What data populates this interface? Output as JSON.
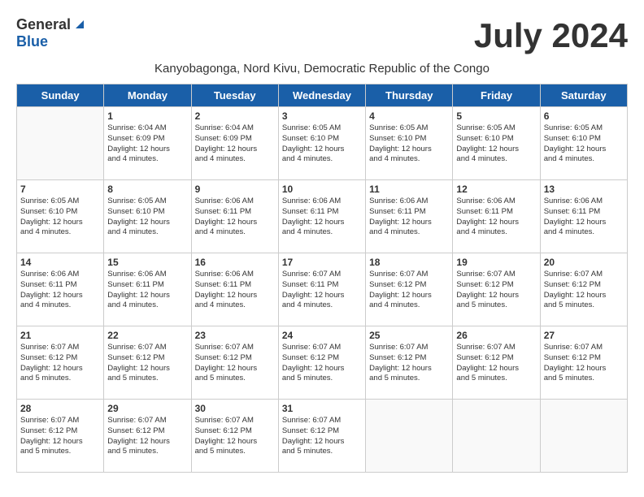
{
  "logo": {
    "general": "General",
    "blue": "Blue"
  },
  "title": "July 2024",
  "location": "Kanyobagonga, Nord Kivu, Democratic Republic of the Congo",
  "days_of_week": [
    "Sunday",
    "Monday",
    "Tuesday",
    "Wednesday",
    "Thursday",
    "Friday",
    "Saturday"
  ],
  "weeks": [
    [
      {
        "num": "",
        "info": ""
      },
      {
        "num": "1",
        "info": "Sunrise: 6:04 AM\nSunset: 6:09 PM\nDaylight: 12 hours\nand 4 minutes."
      },
      {
        "num": "2",
        "info": "Sunrise: 6:04 AM\nSunset: 6:09 PM\nDaylight: 12 hours\nand 4 minutes."
      },
      {
        "num": "3",
        "info": "Sunrise: 6:05 AM\nSunset: 6:10 PM\nDaylight: 12 hours\nand 4 minutes."
      },
      {
        "num": "4",
        "info": "Sunrise: 6:05 AM\nSunset: 6:10 PM\nDaylight: 12 hours\nand 4 minutes."
      },
      {
        "num": "5",
        "info": "Sunrise: 6:05 AM\nSunset: 6:10 PM\nDaylight: 12 hours\nand 4 minutes."
      },
      {
        "num": "6",
        "info": "Sunrise: 6:05 AM\nSunset: 6:10 PM\nDaylight: 12 hours\nand 4 minutes."
      }
    ],
    [
      {
        "num": "7",
        "info": "Sunrise: 6:05 AM\nSunset: 6:10 PM\nDaylight: 12 hours\nand 4 minutes."
      },
      {
        "num": "8",
        "info": "Sunrise: 6:05 AM\nSunset: 6:10 PM\nDaylight: 12 hours\nand 4 minutes."
      },
      {
        "num": "9",
        "info": "Sunrise: 6:06 AM\nSunset: 6:11 PM\nDaylight: 12 hours\nand 4 minutes."
      },
      {
        "num": "10",
        "info": "Sunrise: 6:06 AM\nSunset: 6:11 PM\nDaylight: 12 hours\nand 4 minutes."
      },
      {
        "num": "11",
        "info": "Sunrise: 6:06 AM\nSunset: 6:11 PM\nDaylight: 12 hours\nand 4 minutes."
      },
      {
        "num": "12",
        "info": "Sunrise: 6:06 AM\nSunset: 6:11 PM\nDaylight: 12 hours\nand 4 minutes."
      },
      {
        "num": "13",
        "info": "Sunrise: 6:06 AM\nSunset: 6:11 PM\nDaylight: 12 hours\nand 4 minutes."
      }
    ],
    [
      {
        "num": "14",
        "info": "Sunrise: 6:06 AM\nSunset: 6:11 PM\nDaylight: 12 hours\nand 4 minutes."
      },
      {
        "num": "15",
        "info": "Sunrise: 6:06 AM\nSunset: 6:11 PM\nDaylight: 12 hours\nand 4 minutes."
      },
      {
        "num": "16",
        "info": "Sunrise: 6:06 AM\nSunset: 6:11 PM\nDaylight: 12 hours\nand 4 minutes."
      },
      {
        "num": "17",
        "info": "Sunrise: 6:07 AM\nSunset: 6:11 PM\nDaylight: 12 hours\nand 4 minutes."
      },
      {
        "num": "18",
        "info": "Sunrise: 6:07 AM\nSunset: 6:12 PM\nDaylight: 12 hours\nand 4 minutes."
      },
      {
        "num": "19",
        "info": "Sunrise: 6:07 AM\nSunset: 6:12 PM\nDaylight: 12 hours\nand 5 minutes."
      },
      {
        "num": "20",
        "info": "Sunrise: 6:07 AM\nSunset: 6:12 PM\nDaylight: 12 hours\nand 5 minutes."
      }
    ],
    [
      {
        "num": "21",
        "info": "Sunrise: 6:07 AM\nSunset: 6:12 PM\nDaylight: 12 hours\nand 5 minutes."
      },
      {
        "num": "22",
        "info": "Sunrise: 6:07 AM\nSunset: 6:12 PM\nDaylight: 12 hours\nand 5 minutes."
      },
      {
        "num": "23",
        "info": "Sunrise: 6:07 AM\nSunset: 6:12 PM\nDaylight: 12 hours\nand 5 minutes."
      },
      {
        "num": "24",
        "info": "Sunrise: 6:07 AM\nSunset: 6:12 PM\nDaylight: 12 hours\nand 5 minutes."
      },
      {
        "num": "25",
        "info": "Sunrise: 6:07 AM\nSunset: 6:12 PM\nDaylight: 12 hours\nand 5 minutes."
      },
      {
        "num": "26",
        "info": "Sunrise: 6:07 AM\nSunset: 6:12 PM\nDaylight: 12 hours\nand 5 minutes."
      },
      {
        "num": "27",
        "info": "Sunrise: 6:07 AM\nSunset: 6:12 PM\nDaylight: 12 hours\nand 5 minutes."
      }
    ],
    [
      {
        "num": "28",
        "info": "Sunrise: 6:07 AM\nSunset: 6:12 PM\nDaylight: 12 hours\nand 5 minutes."
      },
      {
        "num": "29",
        "info": "Sunrise: 6:07 AM\nSunset: 6:12 PM\nDaylight: 12 hours\nand 5 minutes."
      },
      {
        "num": "30",
        "info": "Sunrise: 6:07 AM\nSunset: 6:12 PM\nDaylight: 12 hours\nand 5 minutes."
      },
      {
        "num": "31",
        "info": "Sunrise: 6:07 AM\nSunset: 6:12 PM\nDaylight: 12 hours\nand 5 minutes."
      },
      {
        "num": "",
        "info": ""
      },
      {
        "num": "",
        "info": ""
      },
      {
        "num": "",
        "info": ""
      }
    ]
  ]
}
